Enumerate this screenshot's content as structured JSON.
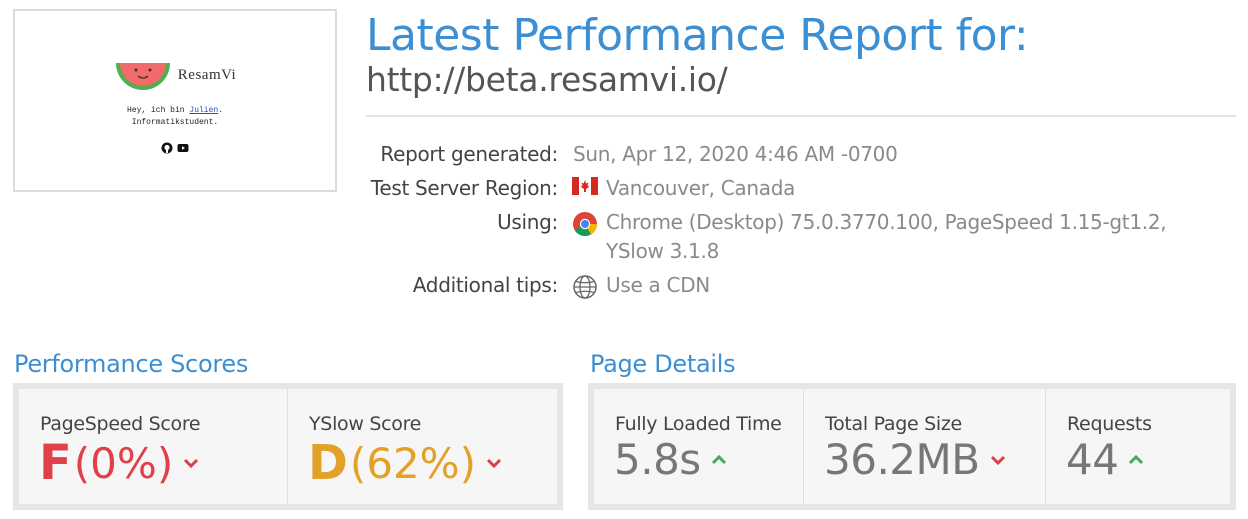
{
  "thumbnail": {
    "brand": "ResamVi",
    "greeting_prefix": "Hey, ich bin ",
    "greeting_link": "Julien",
    "greeting_suffix": ".",
    "subtitle": "Informatikstudent."
  },
  "report": {
    "title": "Latest Performance Report for:",
    "url": "http://beta.resamvi.io/"
  },
  "info": {
    "generated_label": "Report generated:",
    "generated_value": "Sun, Apr 12, 2020 4:46 AM -0700",
    "region_label": "Test Server Region:",
    "region_value": "Vancouver, Canada",
    "using_label": "Using:",
    "using_value_line1": "Chrome (Desktop) 75.0.3770.100, PageSpeed 1.15-gt1.2,",
    "using_value_line2": "YSlow 3.1.8",
    "tips_label": "Additional tips:",
    "tips_value": "Use a CDN"
  },
  "performance": {
    "section_title": "Performance Scores",
    "pagespeed": {
      "label": "PageSpeed Score",
      "grade": "F",
      "percent": "(0%)",
      "trend": "down",
      "color": "#e0404a"
    },
    "yslow": {
      "label": "YSlow Score",
      "grade": "D",
      "percent": "(62%)",
      "trend": "down",
      "color": "#e3a12a"
    }
  },
  "page_details": {
    "section_title": "Page Details",
    "load_time": {
      "label": "Fully Loaded Time",
      "value": "5.8s",
      "trend": "up"
    },
    "page_size": {
      "label": "Total Page Size",
      "value": "36.2MB",
      "trend": "down"
    },
    "requests": {
      "label": "Requests",
      "value": "44",
      "trend": "up"
    }
  },
  "colors": {
    "accent": "#3d8fd3",
    "arrow_up": "#3fae5a",
    "arrow_down": "#d9404c"
  }
}
